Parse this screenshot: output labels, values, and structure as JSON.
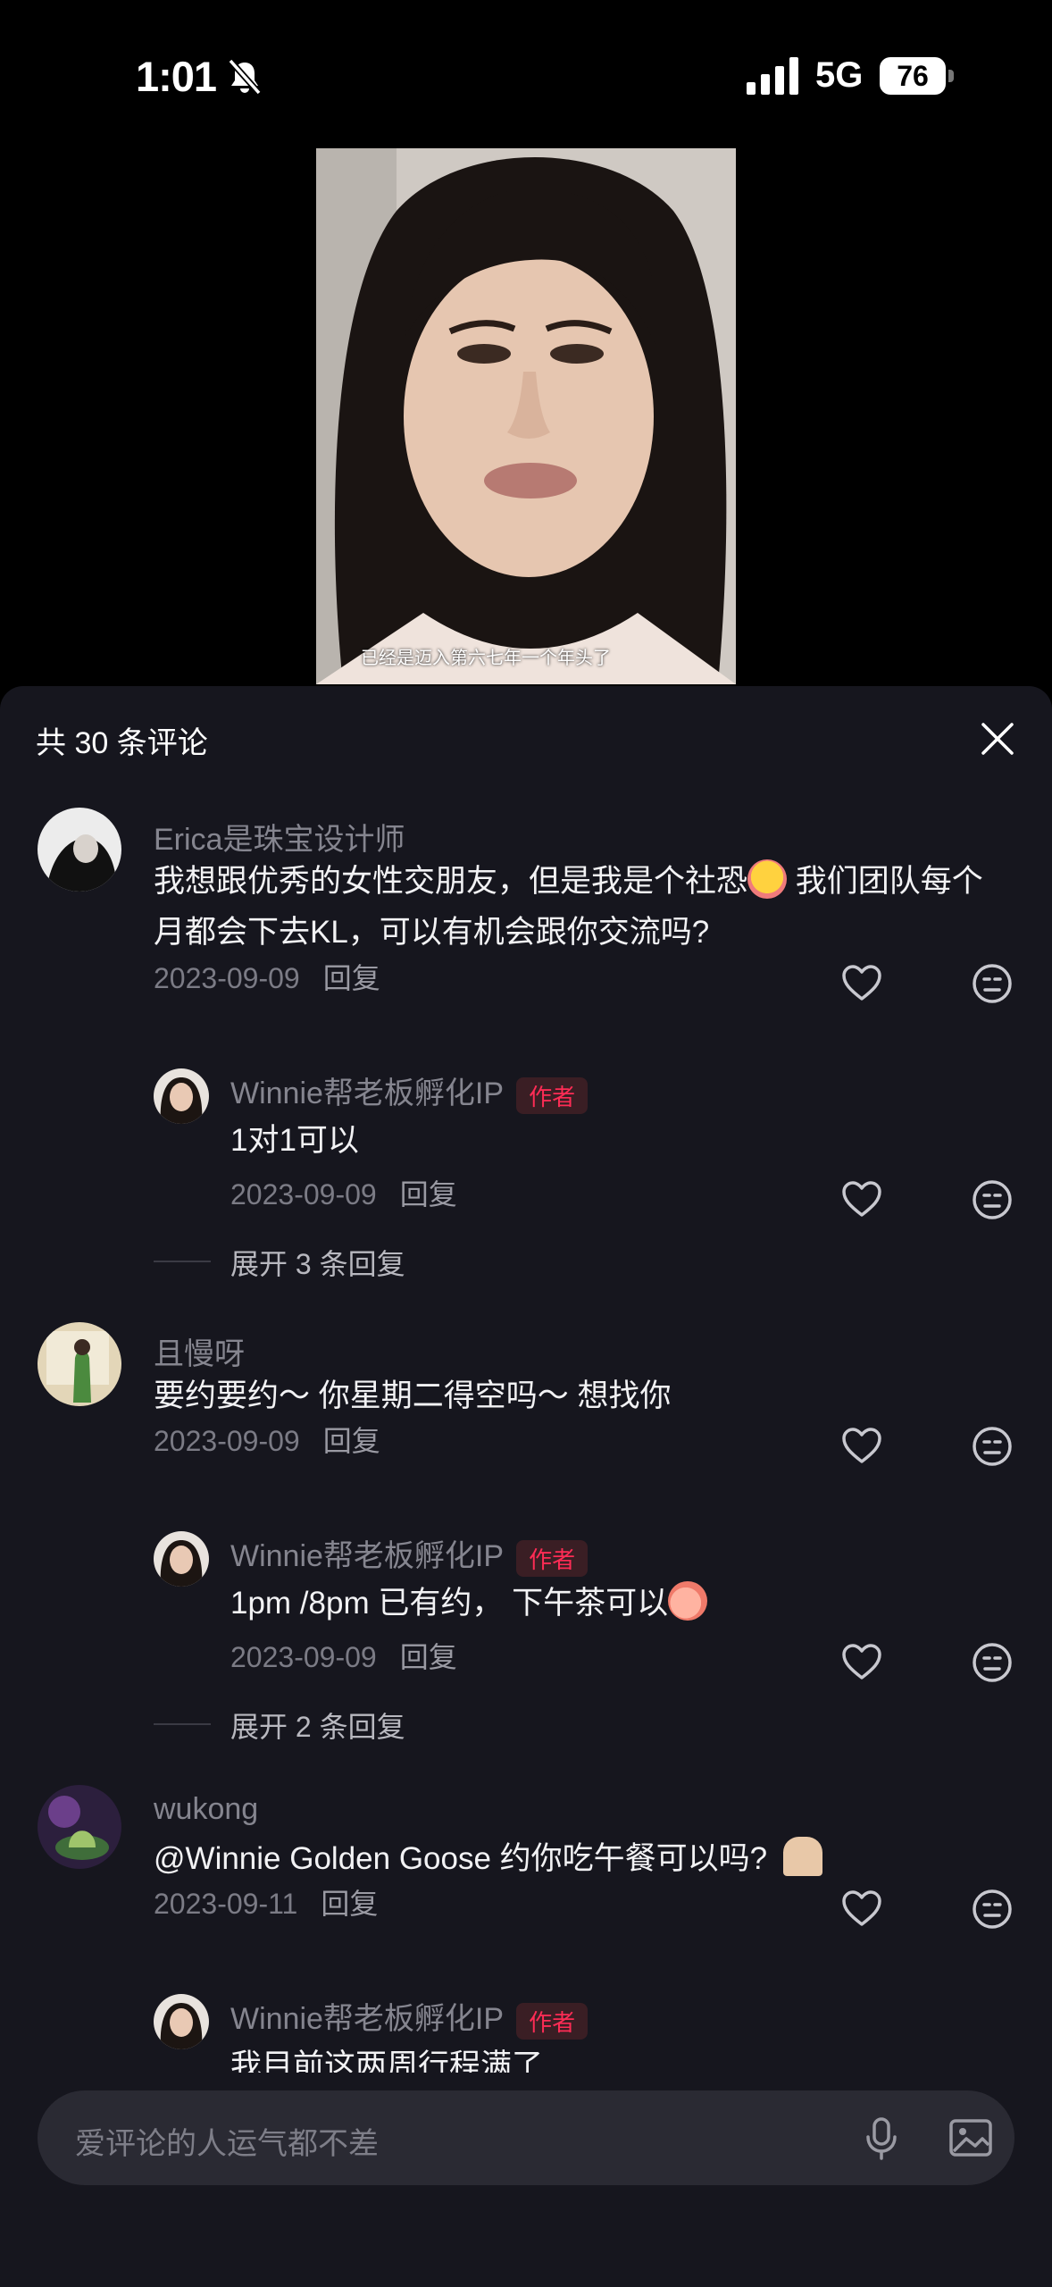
{
  "status_bar": {
    "time": "1:01",
    "network": "5G",
    "battery": "76"
  },
  "video": {
    "caption": "已经是迈入第六七年一个年头了"
  },
  "sheet": {
    "title": "共 30 条评论"
  },
  "comments": [
    {
      "user": "Erica是珠宝设计师",
      "text": "我想跟优秀的女性交朋友，但是我是个社恐",
      "text_after": " 我们团队每个月都会下去KL，可以有机会跟你交流吗?",
      "date": "2023-09-09",
      "reply_label": "回复",
      "replies": [
        {
          "user": "Winnie帮老板孵化IP",
          "badge": "作者",
          "text": "1对1可以",
          "date": "2023-09-09",
          "reply_label": "回复"
        }
      ],
      "expand": "展开 3 条回复"
    },
    {
      "user": "且慢呀",
      "text": "要约要约～ 你星期二得空吗～ 想找你",
      "date": "2023-09-09",
      "reply_label": "回复",
      "replies": [
        {
          "user": "Winnie帮老板孵化IP",
          "badge": "作者",
          "text": "1pm /8pm 已有约， 下午茶可以",
          "date": "2023-09-09",
          "reply_label": "回复"
        }
      ],
      "expand": "展开 2 条回复"
    },
    {
      "user": "wukong",
      "text": "@Winnie Golden Goose 约你吃午餐可以吗?",
      "date": "2023-09-11",
      "reply_label": "回复",
      "replies": [
        {
          "user": "Winnie帮老板孵化IP",
          "badge": "作者",
          "text": "我目前这两周行程满了"
        }
      ]
    }
  ],
  "input": {
    "placeholder": "爱评论的人运气都不差"
  },
  "colors": {
    "sheet_bg": "#16161e",
    "badge_text": "#fe2c55",
    "input_bg": "#2a2a33"
  },
  "icons": [
    "bell-slash-icon",
    "signal-icon",
    "close-icon",
    "heart-icon",
    "dislike-face-icon",
    "mic-icon",
    "image-icon"
  ]
}
